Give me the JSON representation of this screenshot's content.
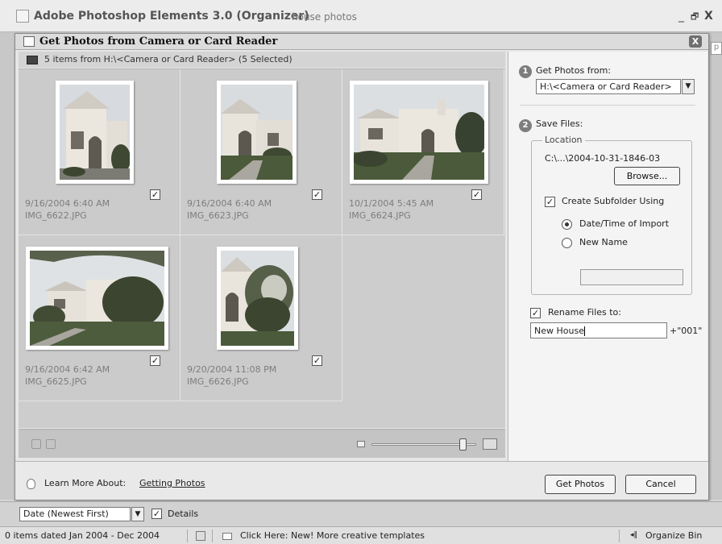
{
  "app": {
    "title": "Adobe Photoshop Elements 3.0 (Organizer)",
    "subtitle": "house photos",
    "minimize_glyph": "_",
    "restore_glyph": "🗗",
    "close_glyph": "X",
    "help_letter": "p"
  },
  "dialog": {
    "title": "Get Photos from Camera or Card Reader",
    "close_glyph": "X",
    "summary": "5 items from H:\\<Camera or Card Reader> (5 Selected)"
  },
  "photos": [
    {
      "date": "9/16/2004 6:40 AM",
      "file": "IMG_6622.JPG",
      "checked": true,
      "check_glyph": "✓"
    },
    {
      "date": "9/16/2004 6:40 AM",
      "file": "IMG_6623.JPG",
      "checked": true,
      "check_glyph": "✓"
    },
    {
      "date": "10/1/2004 5:45 AM",
      "file": "IMG_6624.JPG",
      "checked": true,
      "check_glyph": "✓"
    },
    {
      "date": "9/16/2004 6:42 AM",
      "file": "IMG_6625.JPG",
      "checked": true,
      "check_glyph": "✓"
    },
    {
      "date": "9/20/2004 11:08 PM",
      "file": "IMG_6626.JPG",
      "checked": true,
      "check_glyph": "✓"
    }
  ],
  "thumb_toolbar": {
    "zoom_level": 0.88
  },
  "settings": {
    "step1_number": "1",
    "step1_label": "Get Photos from:",
    "source_value": "H:\\<Camera or Card Reader>",
    "dropdown_glyph": "▼",
    "step2_number": "2",
    "step2_label": "Save Files:",
    "location_label": "Location",
    "location_path": "C:\\...\\2004-10-31-1846-03",
    "browse_label": "Browse...",
    "subfolder_label": "Create Subfolder Using",
    "subfolder_checked": true,
    "check_glyph": "✓",
    "radio_datetime_label": "Date/Time of Import",
    "radio_datetime_selected": true,
    "radio_newname_label": "New Name",
    "radio_newname_selected": false,
    "new_name_value": "",
    "rename_label": "Rename Files to:",
    "rename_checked": true,
    "rename_value": "New House",
    "rename_suffix": "+\"001\""
  },
  "footer": {
    "learn_label": "Learn More About:",
    "learn_link": "Getting Photos",
    "get_photos_label": "Get Photos",
    "cancel_label": "Cancel"
  },
  "organizer": {
    "sort_value": "Date (Newest First)",
    "details_label": "Details",
    "details_checked": true,
    "status_text": "0 items dated Jan 2004 - Dec 2004",
    "promo_text": "Click Here: New! More creative templates",
    "organize_bin_label": "Organize Bin",
    "organize_bin_glyph": "◂‖"
  },
  "colors": {
    "grid_bg": "#cbcbcb",
    "panel_bg": "#f4f4f4",
    "sky": "#d8dbe0",
    "stucco": "#e9e6df",
    "grass": "#4a5a3a",
    "foliage": "#3c4530"
  }
}
